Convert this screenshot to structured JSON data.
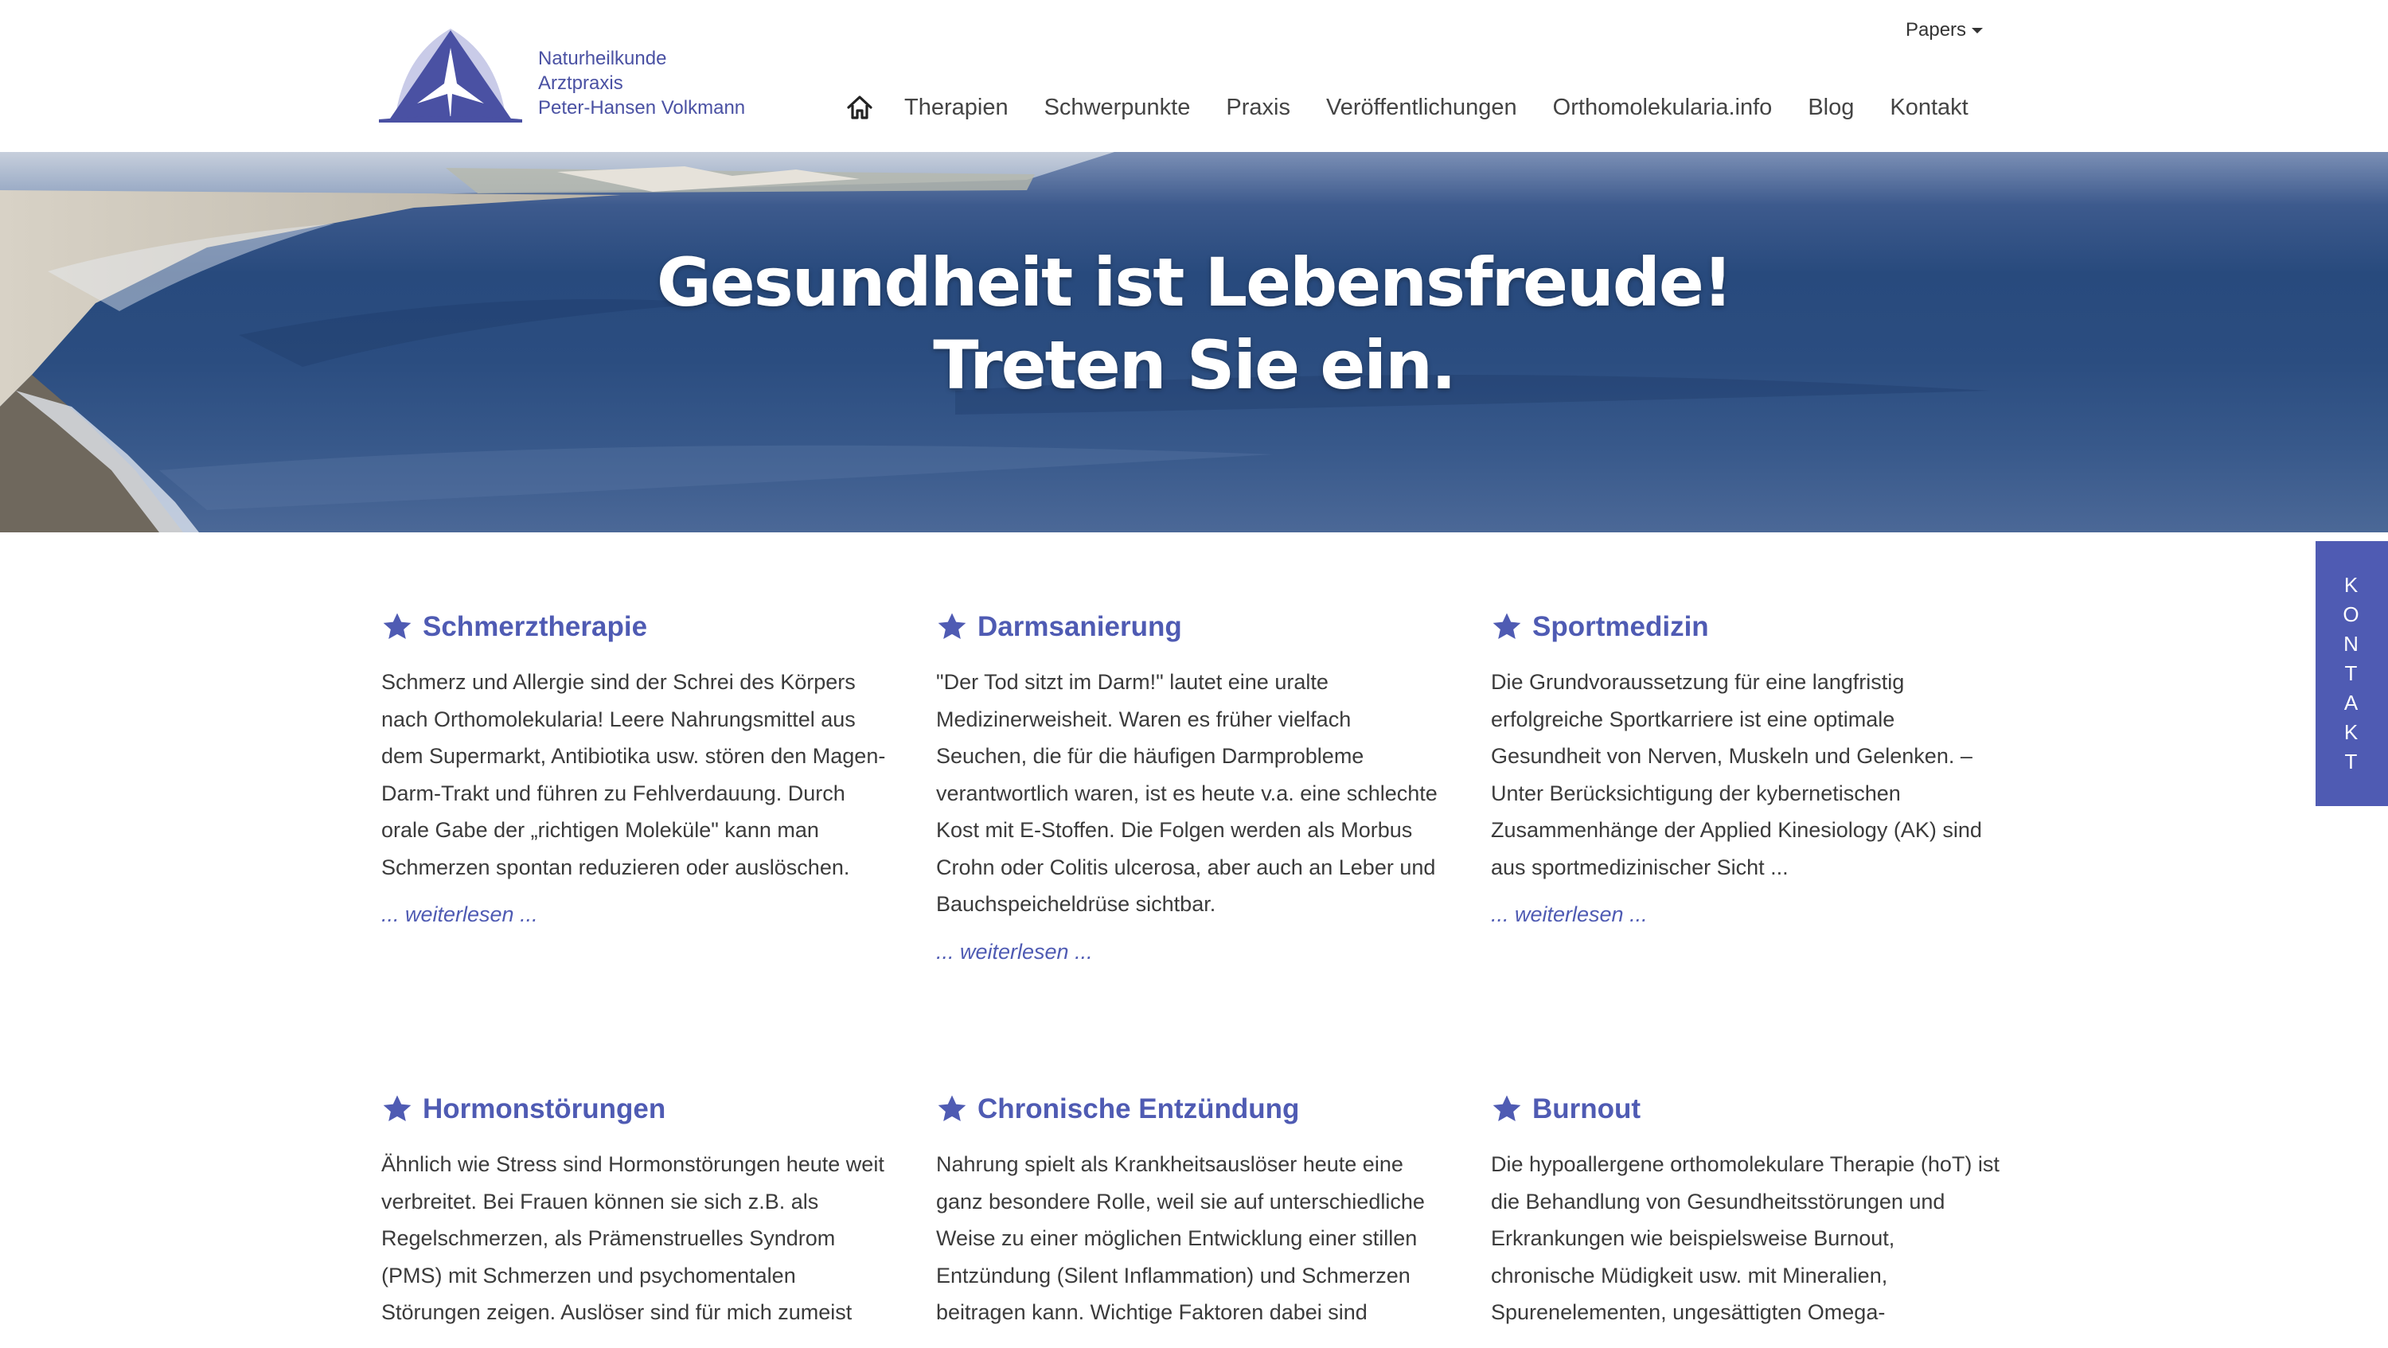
{
  "brand": {
    "line1": "Naturheilkunde",
    "line2": "Arztpraxis",
    "line3": "Peter-Hansen Volkmann",
    "accent": "#4f5bb3"
  },
  "topbar": {
    "papers_label": "Papers"
  },
  "nav": {
    "home_icon": "home-icon",
    "items": [
      "Therapien",
      "Schwerpunkte",
      "Praxis",
      "Veröffentlichungen",
      "Orthomolekularia.info",
      "Blog",
      "Kontakt"
    ]
  },
  "hero": {
    "line1": "Gesundheit ist Lebensfreude!",
    "line2": "Treten Sie ein."
  },
  "cards": [
    {
      "title": "Schmerztherapie",
      "text": "Schmerz und Allergie sind der Schrei des Körpers nach Orthomolekularia! Leere Nahrungsmittel aus dem Supermarkt, Antibiotika usw. stören den Magen-Darm-Trakt und führen zu Fehlverdauung. Durch orale Gabe der „richtigen Moleküle\" kann man Schmerzen spontan reduzieren oder auslöschen.",
      "more": "... weiterlesen ..."
    },
    {
      "title": "Darmsanierung",
      "text": "\"Der Tod sitzt im Darm!\" lautet eine uralte Medizinerweisheit. Waren es früher vielfach Seuchen, die für die häufigen Darmprobleme verantwortlich waren, ist es heute v.a. eine schlechte Kost mit E-Stoffen. Die Folgen werden als Morbus Crohn oder Colitis ulcerosa, aber auch an Leber und Bauchspeicheldrüse sichtbar.",
      "more": "... weiterlesen ..."
    },
    {
      "title": "Sportmedizin",
      "text": "Die Grundvoraussetzung für eine langfristig erfolgreiche Sportkarriere ist eine optimale Gesundheit von Nerven, Muskeln und Gelenken. – Unter Berücksichtigung der kybernetischen Zusammenhänge der Applied Kinesiology (AK) sind aus sportmedizinischer Sicht ...",
      "more": "... weiterlesen ..."
    },
    {
      "title": "Hormonstörungen",
      "text": "Ähnlich wie Stress sind Hormonstörungen heute weit verbreitet. Bei Frauen können sie sich z.B. als Regelschmerzen, als Prämenstruelles Syndrom (PMS) mit Schmerzen und psychomentalen Störungen zeigen. Auslöser sind für mich zumeist",
      "more": ""
    },
    {
      "title": "Chronische Entzündung",
      "text": "Nahrung spielt als Krankheitsauslöser heute eine ganz besondere Rolle, weil sie auf unterschiedliche Weise zu einer möglichen Entwicklung einer stillen Entzündung (Silent Inflammation) und Schmerzen beitragen kann. Wichtige Faktoren dabei sind",
      "more": ""
    },
    {
      "title": "Burnout",
      "text": "Die hypoallergene orthomolekulare Therapie (hoT) ist die Behandlung von Gesundheitsstörungen und Erkrankungen wie beispielsweise Burnout, chronische Müdigkeit usw. mit Mineralien, Spurenelementen, ungesättigten Omega-",
      "more": ""
    }
  ],
  "side_tab": {
    "letters": [
      "K",
      "O",
      "N",
      "T",
      "A",
      "K",
      "T"
    ]
  }
}
